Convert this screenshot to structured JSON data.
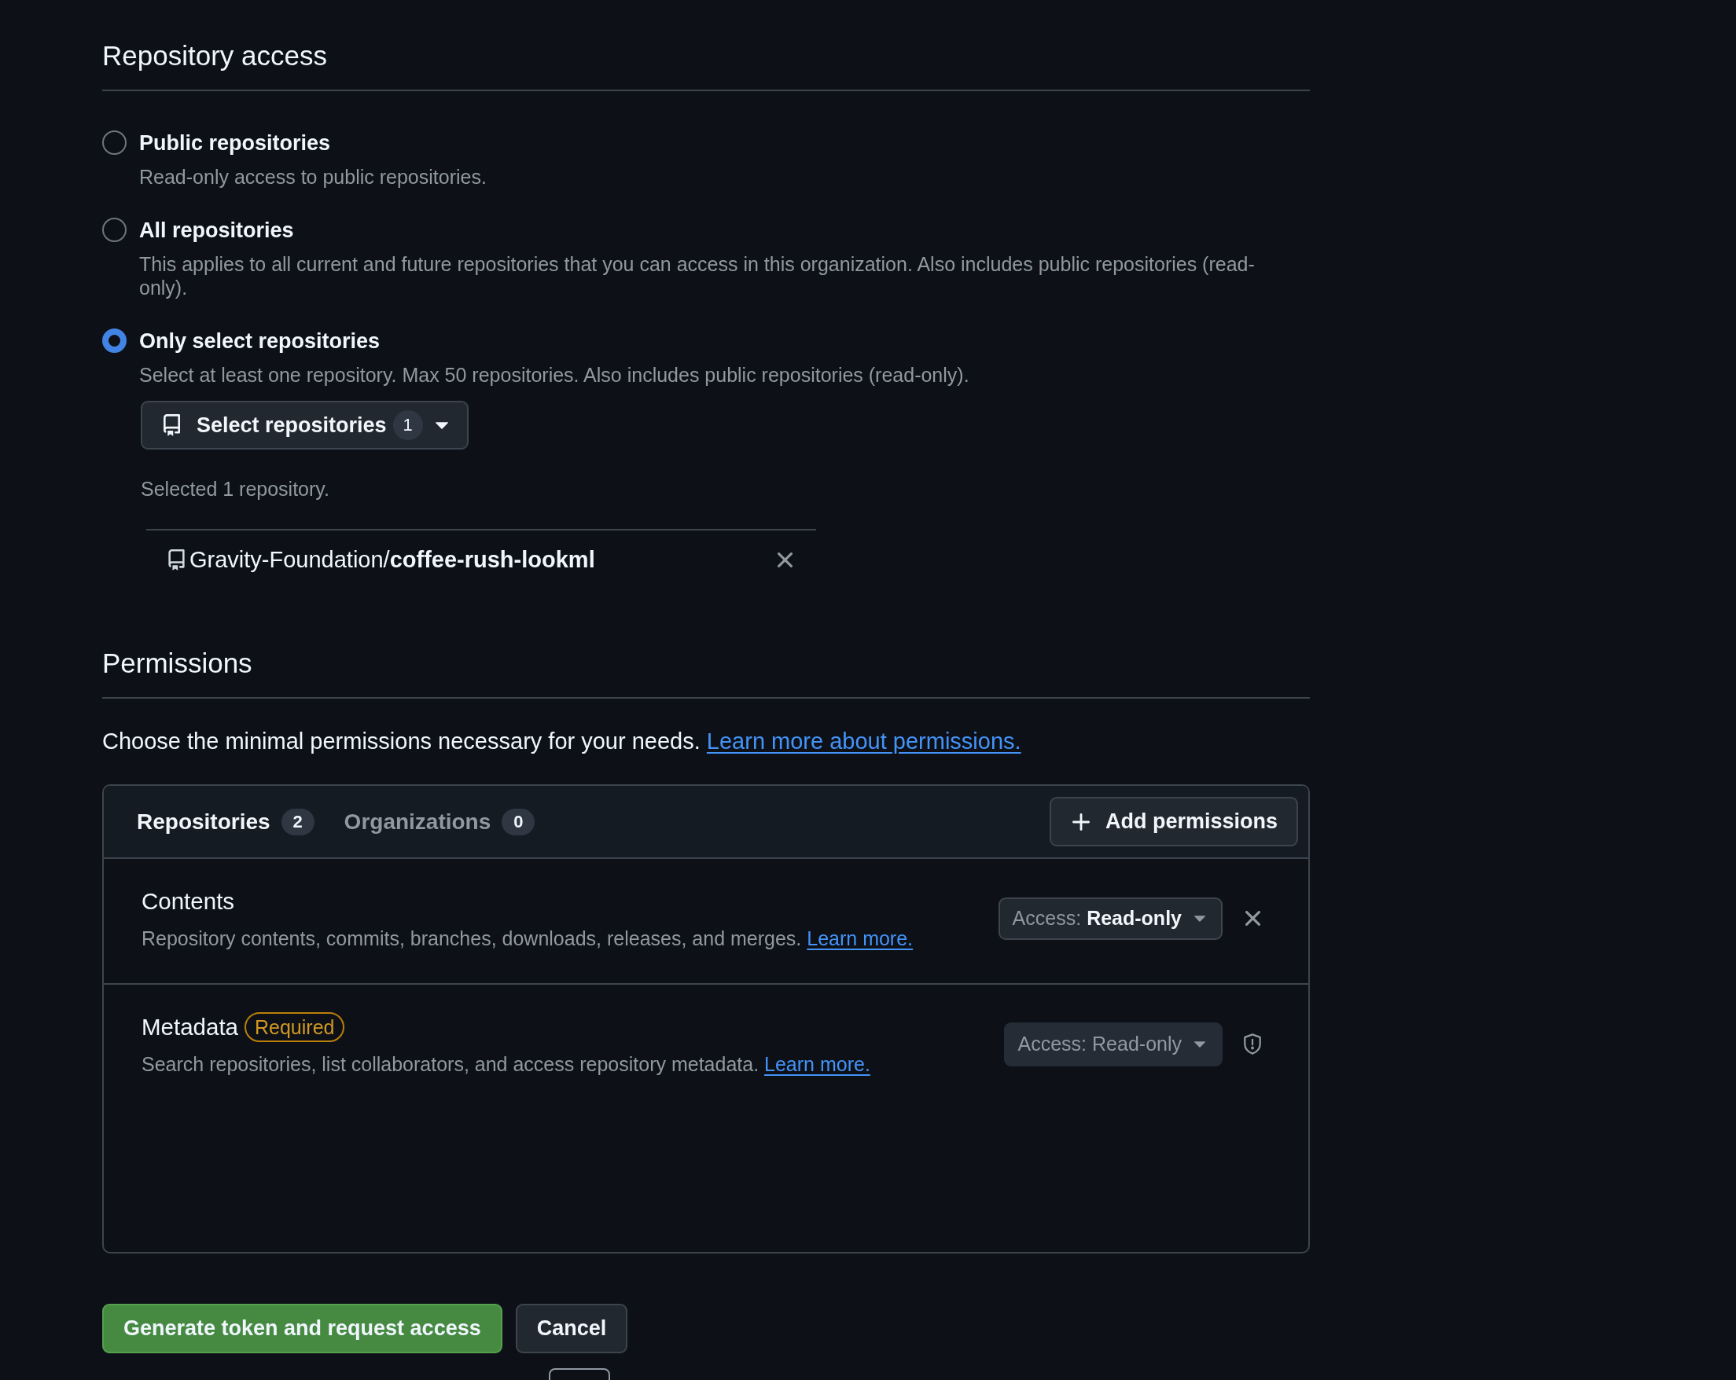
{
  "repository_access": {
    "heading": "Repository access",
    "options": [
      {
        "label": "Public repositories",
        "description": "Read-only access to public repositories.",
        "selected": false
      },
      {
        "label": "All repositories",
        "description": "This applies to all current and future repositories that you can access in this organization. Also includes public repositories (read-only).",
        "selected": false
      },
      {
        "label": "Only select repositories",
        "description": "Select at least one repository. Max 50 repositories. Also includes public repositories (read-only).",
        "selected": true
      }
    ],
    "select_button": {
      "label": "Select repositories",
      "count": "1"
    },
    "selected_summary": "Selected 1 repository.",
    "selected_repositories": [
      {
        "name": "Gravity-Foundation/**coffee-rush-lookml**"
      }
    ]
  },
  "permissions": {
    "heading": "Permissions",
    "intro": "Choose the minimal permissions necessary for your needs.",
    "intro_link": "Learn more about permissions.",
    "tabs": [
      {
        "label": "Repositories",
        "count": "2",
        "selected": true
      },
      {
        "label": "Organizations",
        "count": "0",
        "selected": false
      }
    ],
    "add_button": "Add permissions",
    "items": [
      {
        "name": "Contents",
        "description": "Repository contents, commits, branches, downloads, releases, and merges.",
        "link": "Learn more.",
        "access_label": "Access:",
        "access_value": "Read-only",
        "disabled": false,
        "kind": "remove"
      },
      {
        "name": "Metadata",
        "badge": "Required",
        "description": "Search repositories, list collaborators, and access repository metadata.",
        "link": "Learn more.",
        "access_label": "Access:",
        "access_value": "Read-only",
        "disabled": true,
        "kind": "locked"
      }
    ]
  },
  "actions": {
    "primary": "Generate token and request access",
    "secondary": "Cancel"
  }
}
